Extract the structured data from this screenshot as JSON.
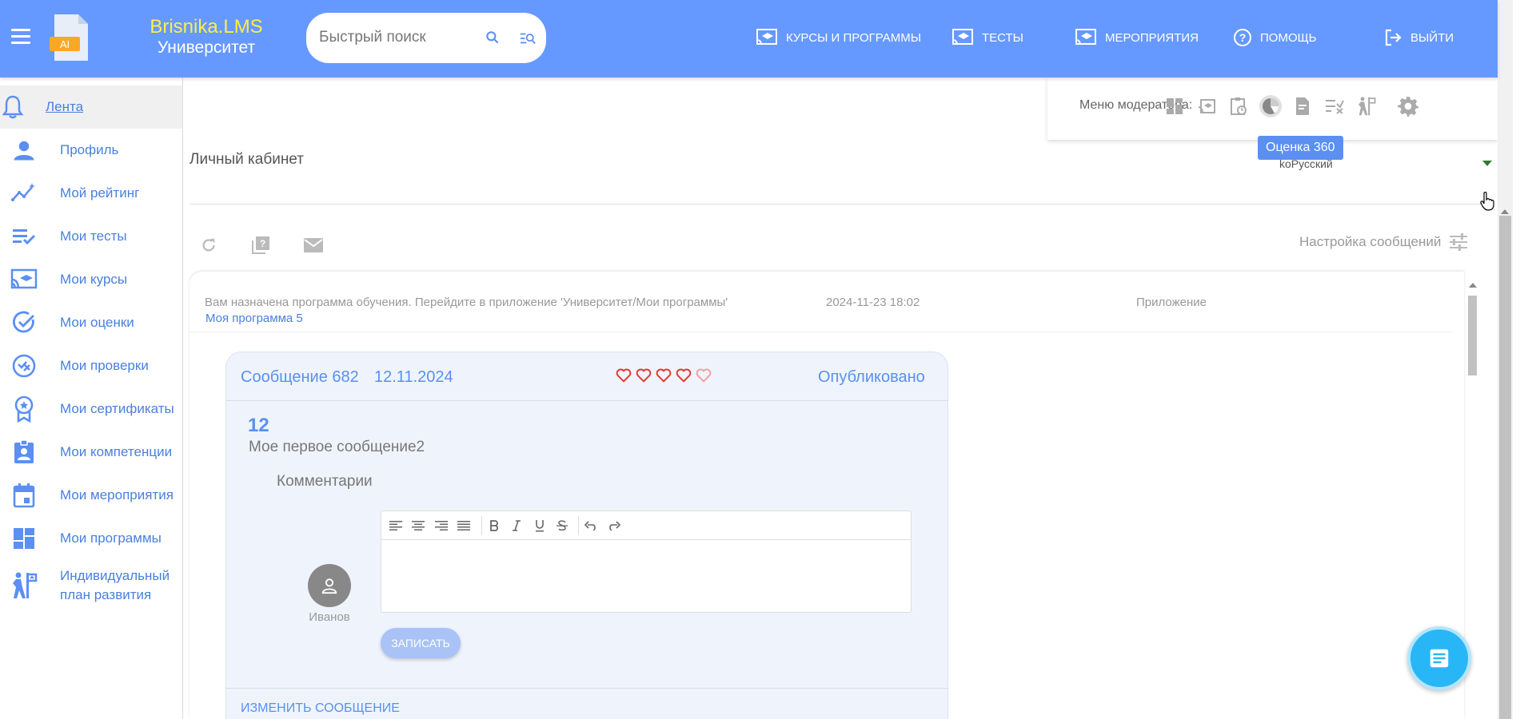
{
  "header": {
    "brand_line1": "Brisnika.LMS",
    "brand_line2": "Университет",
    "logo_badge": "AI",
    "search_placeholder": "Быстрый поиск",
    "nav": [
      {
        "label": "КУРСЫ И ПРОГРАММЫ",
        "icon": "courses-icon"
      },
      {
        "label": "ТЕСТЫ",
        "icon": "tests-icon"
      },
      {
        "label": "МЕРОПРИЯТИЯ",
        "icon": "events-icon"
      },
      {
        "label": "ПОМОЩЬ",
        "icon": "help-icon"
      },
      {
        "label": "ВЫЙТИ",
        "icon": "logout-icon"
      }
    ]
  },
  "sidebar": {
    "items": [
      {
        "label": "Лента",
        "icon": "bell-icon",
        "active": true
      },
      {
        "label": "Профиль",
        "icon": "person-icon"
      },
      {
        "label": "Мой рейтинг",
        "icon": "rating-icon"
      },
      {
        "label": "Мои тесты",
        "icon": "checklist-icon"
      },
      {
        "label": "Мои курсы",
        "icon": "cast-icon"
      },
      {
        "label": "Мои оценки",
        "icon": "check-circle-icon"
      },
      {
        "label": "Мои проверки",
        "icon": "review-icon"
      },
      {
        "label": "Мои сертификаты",
        "icon": "badge-icon"
      },
      {
        "label": "Мои компетенции",
        "icon": "clipboard-person-icon"
      },
      {
        "label": "Мои мероприятия",
        "icon": "calendar-icon"
      },
      {
        "label": "Мои программы",
        "icon": "dashboard-icon"
      },
      {
        "label": "Индивидуальный план развития",
        "icon": "growth-icon"
      }
    ]
  },
  "moderator": {
    "label": "Меню модератора:",
    "tooltip": "Оценка 360",
    "icons": [
      "dashboard-icon",
      "assignment-icon",
      "clipboard-clock-icon",
      "pie-chart-icon",
      "document-icon",
      "checklist-x-icon",
      "growth-icon",
      "gear-icon"
    ]
  },
  "language": "ko",
  "language_text": "Русский",
  "page_title": "Личный кабинет",
  "toolbar": {
    "settings_label": "Настройка сообщений"
  },
  "notification": {
    "text": "Вам назначена программа обучения. Перейдите в приложение 'Университет/Мои программы'",
    "date": "2024-11-23 18:02",
    "source": "Приложение",
    "link": "Моя программа 5"
  },
  "message": {
    "title": "Сообщение 682",
    "date": "12.11.2024",
    "rating": 4,
    "rating_max": 5,
    "status": "Опубликовано",
    "number": "12",
    "body": "Мое первое сообщение2",
    "comments_label": "Комментарии",
    "author": "Иванов",
    "save_label": "ЗАПИСАТЬ",
    "edit_label": "ИЗМЕНИТЬ СООБЩЕНИЕ"
  },
  "colors": {
    "header": "#6699ff",
    "accent": "#5b8ff2",
    "brand_yellow": "#ffee44",
    "heart": "#e53935",
    "fab": "#29b6f6"
  }
}
